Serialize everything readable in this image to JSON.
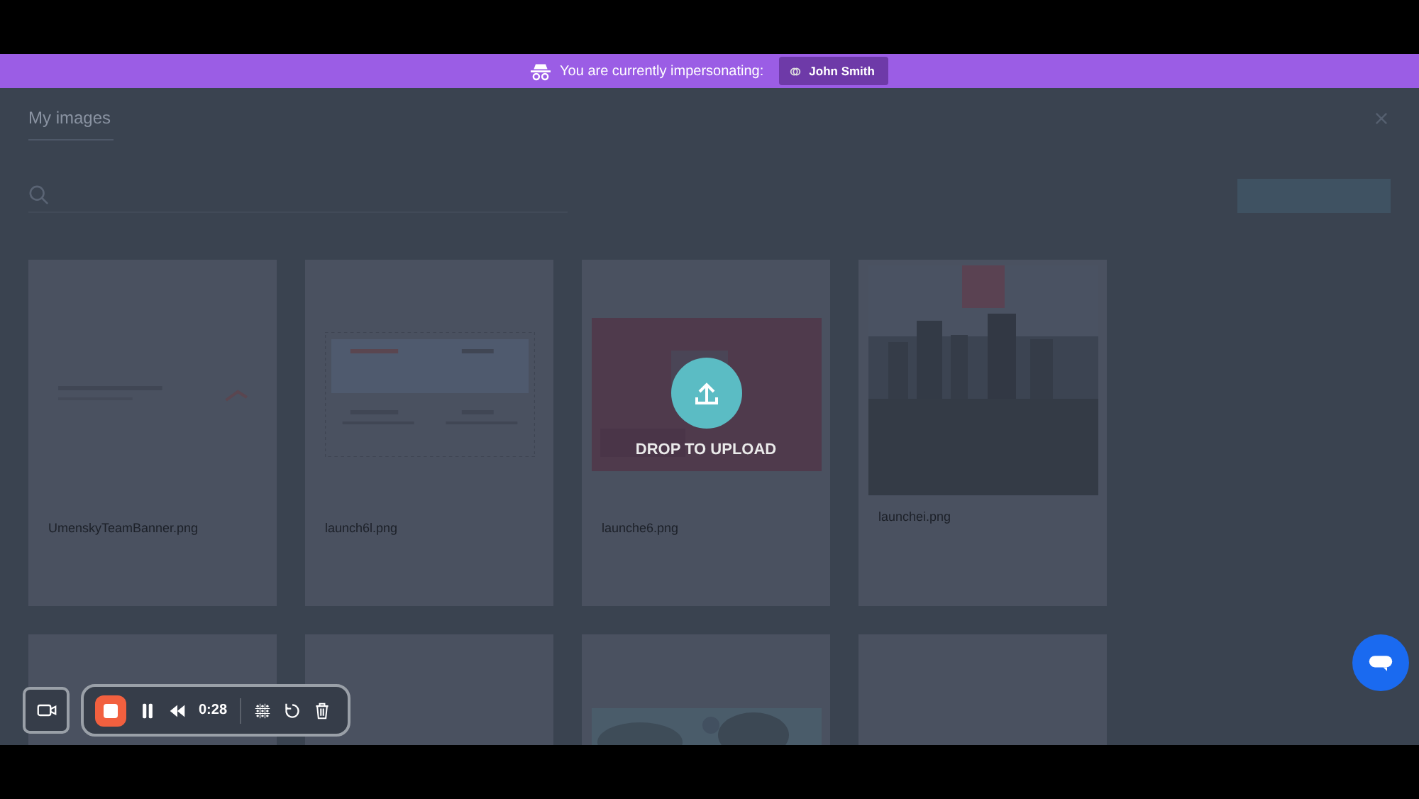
{
  "banner": {
    "text": "You are currently impersonating:",
    "user": "John Smith"
  },
  "modal": {
    "title": "My images",
    "tab_active": true
  },
  "images": [
    {
      "filename": "UmenskyTeamBanner.png",
      "kind": "document"
    },
    {
      "filename": "launch6l.png",
      "kind": "table"
    },
    {
      "filename": "launche6.png",
      "kind": "picture",
      "drop_overlay": "DROP TO UPLOAD"
    },
    {
      "filename": "launchei.png",
      "kind": "city"
    },
    {
      "kind": "blank"
    },
    {
      "kind": "blank"
    },
    {
      "kind": "landscape"
    },
    {
      "kind": "blank"
    }
  ],
  "recorder": {
    "time": "0:28",
    "recording": true
  }
}
